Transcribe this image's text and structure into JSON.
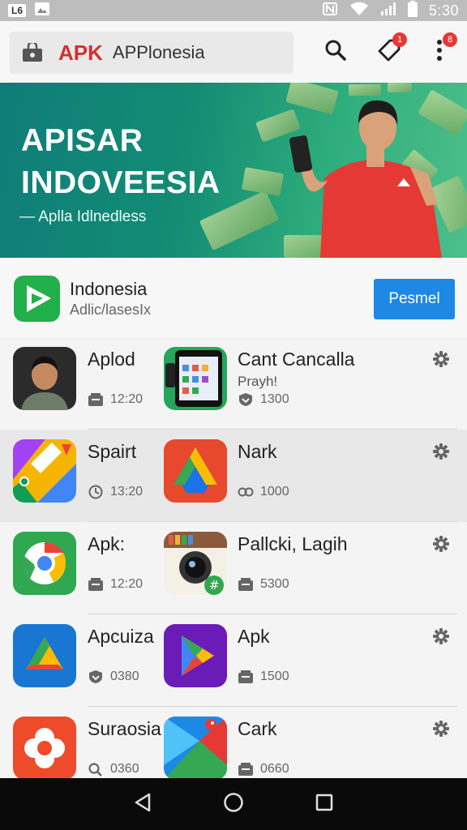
{
  "status_bar": {
    "carrier_chip": "L6",
    "time": "5:30"
  },
  "app_bar": {
    "brand": "APK",
    "title": "APPlonesia",
    "notification_count": "1",
    "menu_count": "8"
  },
  "hero": {
    "title_line1": "APISAR",
    "title_line2": "INDOVEESIA",
    "subtitle": "— Aplla Idlnedless"
  },
  "promo": {
    "title": "Indonesia",
    "subtitle": "Adlic/lasesIx",
    "button_label": "Pesmel"
  },
  "apps": [
    {
      "left": {
        "name": "Aplod",
        "meta": "12:20",
        "icon": "profile-photo-icon"
      },
      "right": {
        "name": "Cant Cancalla",
        "sub": "Prayh!",
        "meta": "1300",
        "icon": "phone-app-icon"
      }
    },
    {
      "left": {
        "name": "Spairt",
        "meta": "13:20",
        "icon": "maps-icon"
      },
      "right": {
        "name": "Nark",
        "meta": "1000",
        "icon": "drive-icon"
      }
    },
    {
      "left": {
        "name": "Apk:",
        "meta": "12:20",
        "icon": "chrome-icon"
      },
      "right": {
        "name": "Pallcki, Lagih",
        "meta": "5300",
        "icon": "camera-icon"
      }
    },
    {
      "left": {
        "name": "Apcuiza",
        "meta": "0380",
        "icon": "drive-blue-icon"
      },
      "right": {
        "name": "Apk",
        "meta": "1500",
        "icon": "play-icon"
      }
    },
    {
      "left": {
        "name": "Suraosia",
        "meta": "0360",
        "icon": "flower-icon"
      },
      "right": {
        "name": "Cark",
        "meta": "0660",
        "icon": "play-bird-icon"
      }
    }
  ]
}
